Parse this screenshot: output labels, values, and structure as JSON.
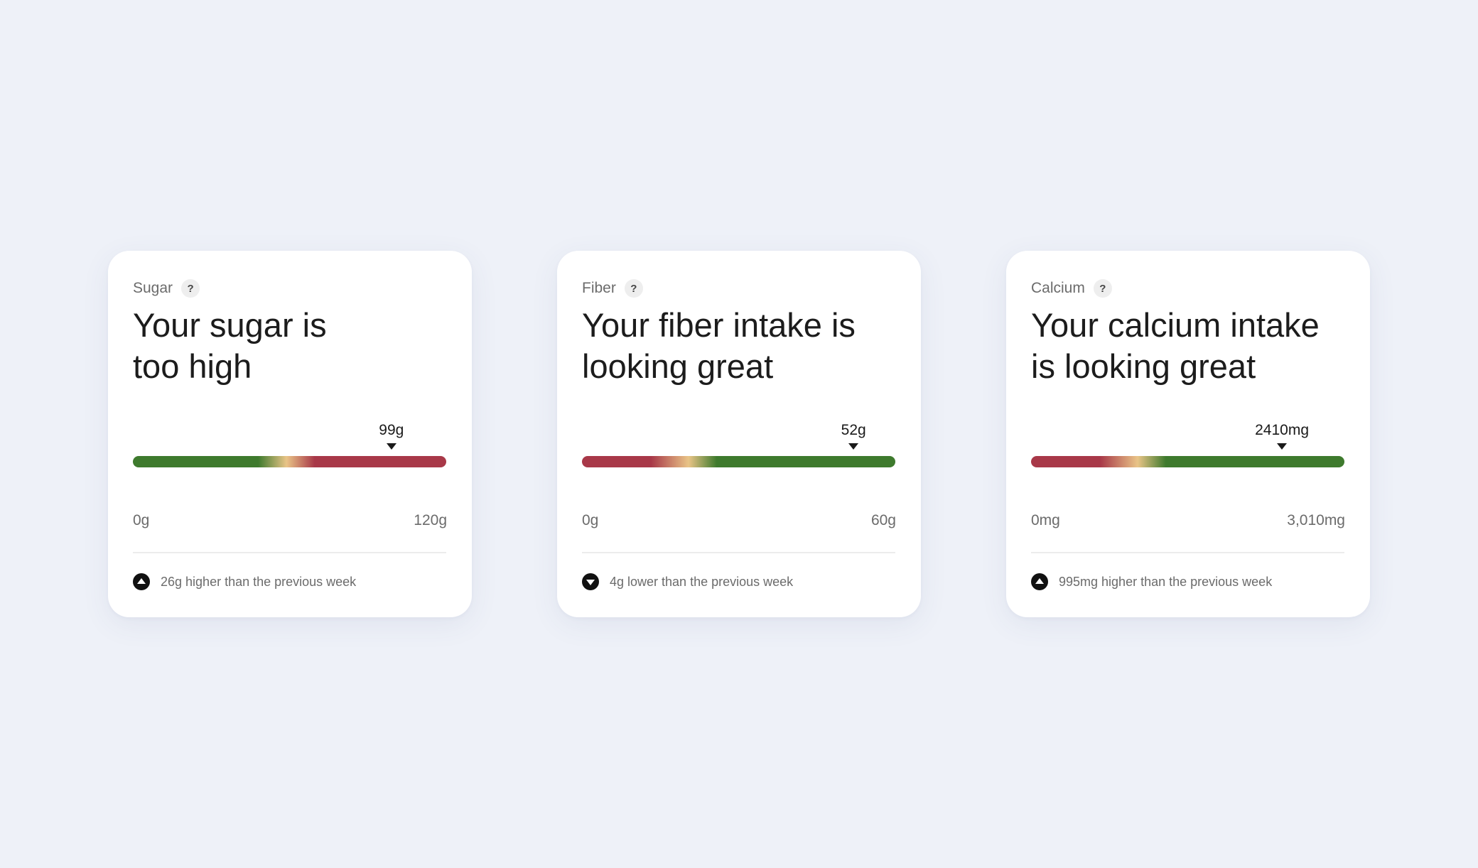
{
  "colors": {
    "background": "#eef1f8",
    "good": "#3e7a2d",
    "warn": "#e9c487",
    "bad": "#a83848"
  },
  "cards": [
    {
      "label": "Sugar",
      "help": "?",
      "headline": "Your sugar is\ntoo high",
      "value_label": "99g",
      "value": 99,
      "min": 0,
      "max": 120,
      "min_label": "0g",
      "max_label": "120g",
      "gauge_direction": "green-to-red",
      "trend": "up",
      "trend_icon": "arrow-up-circle-icon",
      "trend_text": "26g higher than the previous week"
    },
    {
      "label": "Fiber",
      "help": "?",
      "headline": "Your fiber intake is\nlooking great",
      "value_label": "52g",
      "value": 52,
      "min": 0,
      "max": 60,
      "min_label": "0g",
      "max_label": "60g",
      "gauge_direction": "red-to-green",
      "trend": "down",
      "trend_icon": "arrow-down-circle-icon",
      "trend_text": "4g lower than the previous week"
    },
    {
      "label": "Calcium",
      "help": "?",
      "headline": "Your calcium intake\nis looking great",
      "value_label": "2410mg",
      "value": 2410,
      "min": 0,
      "max": 3010,
      "min_label": "0mg",
      "max_label": "3,010mg",
      "gauge_direction": "red-to-green",
      "trend": "up",
      "trend_icon": "arrow-up-circle-icon",
      "trend_text": "995mg higher than the previous week"
    }
  ]
}
